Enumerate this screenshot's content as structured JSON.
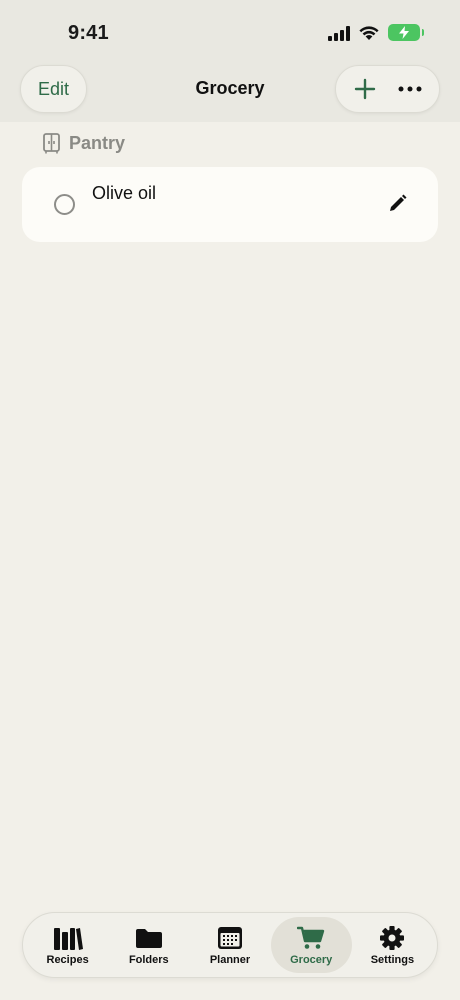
{
  "status_bar": {
    "time": "9:41"
  },
  "header": {
    "edit_label": "Edit",
    "title": "Grocery"
  },
  "sections": [
    {
      "label": "Pantry",
      "icon": "pantry-cabinet-icon",
      "items": [
        {
          "name": "Olive oil",
          "checked": false
        }
      ]
    }
  ],
  "tab_bar": {
    "tabs": [
      {
        "label": "Recipes",
        "icon": "books-icon",
        "active": false
      },
      {
        "label": "Folders",
        "icon": "folder-icon",
        "active": false
      },
      {
        "label": "Planner",
        "icon": "calendar-icon",
        "active": false
      },
      {
        "label": "Grocery",
        "icon": "cart-icon",
        "active": true
      },
      {
        "label": "Settings",
        "icon": "gear-icon",
        "active": false
      }
    ]
  },
  "colors": {
    "accent": "#2f6b48",
    "background": "#f2f0e9",
    "battery": "#4cc561"
  }
}
